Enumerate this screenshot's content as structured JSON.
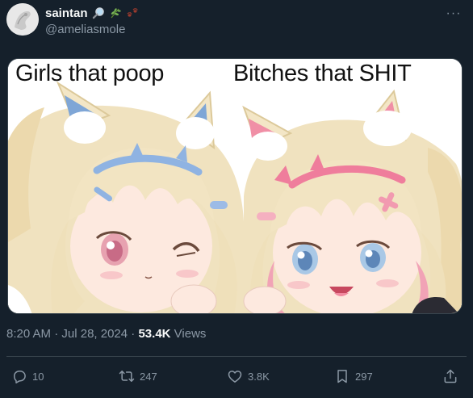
{
  "author": {
    "display_name": "saintan",
    "handle": "@ameliasmole",
    "badges": [
      "magnifying-glass-icon",
      "herb-icon",
      "paw-prints-icon"
    ]
  },
  "menu": {
    "more_label": "···"
  },
  "media": {
    "caption_left": "Girls that poop",
    "caption_right": "Bitches that SHIT"
  },
  "meta": {
    "time": "8:20 AM",
    "separator": " · ",
    "date": "Jul 28, 2024",
    "separator2": " · ",
    "views_count": "53.4K",
    "views_label": " Views"
  },
  "actions": {
    "reply_count": "10",
    "repost_count": "247",
    "like_count": "3.8K",
    "bookmark_count": "297"
  },
  "colors": {
    "background": "#15202b",
    "secondary_text": "#8b98a5",
    "primary_text": "#f7f9f9",
    "divider": "#38444d"
  }
}
